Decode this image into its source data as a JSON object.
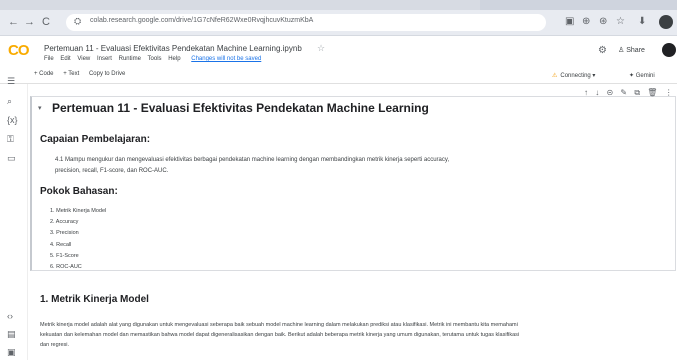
{
  "browser": {
    "url": "colab.research.google.com/drive/1G7cNfeR62Wxe0RvqjhcuvKtuzmKbA",
    "nav": {
      "back": "←",
      "forward": "→",
      "reload": "C",
      "site_info": "⛭"
    },
    "extensions": [
      "▣",
      "⊕",
      "⊛",
      "☆",
      "⬇"
    ]
  },
  "colab": {
    "logo": "CO",
    "notebook_title": "Pertemuan 11 - Evaluasi Efektivitas Pendekatan Machine Learning.ipynb",
    "menu": [
      "File",
      "Edit",
      "View",
      "Insert",
      "Runtime",
      "Tools",
      "Help"
    ],
    "last_edit": "Changes will not be saved",
    "share_label": "Share"
  },
  "toolbar": {
    "add_code": "+ Code",
    "add_text": "+ Text",
    "copy_drive": "Copy to Drive",
    "connect_label": "Connecting",
    "connect_dropdown": "▾",
    "edit_label": "✦ Gemini"
  },
  "cell_tools": [
    "↑",
    "↓",
    "⊝",
    "✎",
    "⧉",
    "🗑",
    "⋮"
  ],
  "notebook": {
    "title": "Pertemuan 11 - Evaluasi Efektivitas Pendekatan Machine Learning",
    "capaian_heading": "Capaian Pembelajaran:",
    "capaian_text": "4.1 Mampu mengukur dan mengevaluasi efektivitas berbagai pendekatan machine learning dengan membandingkan metrik kinerja seperti accuracy, precision, recall, F1-score, dan ROC-AUC.",
    "pokok_heading": "Pokok Bahasan:",
    "pokok_items": [
      "1. Metrik Kinerja Model",
      "2. Accuracy",
      "3. Precision",
      "4. Recall",
      "5. F1-Score",
      "6. ROC-AUC"
    ],
    "metrik_heading": "1. Metrik Kinerja Model",
    "metrik_text": "Metrik kinerja model adalah alat yang digunakan untuk mengevaluasi seberapa baik sebuah model machine learning dalam melakukan prediksi atau klasifikasi. Metrik ini membantu kita memahami kekuatan dan kelemahan model dan memastikan bahwa model dapat digeneralisasikan dengan baik. Berikut adalah beberapa metrik kinerja yang umum digunakan, terutama untuk tugas klasifikasi dan regresi."
  },
  "colors": {
    "accent": "#1a73e8",
    "logo": "#f9ab00",
    "chrome": "#e8ebf1"
  }
}
